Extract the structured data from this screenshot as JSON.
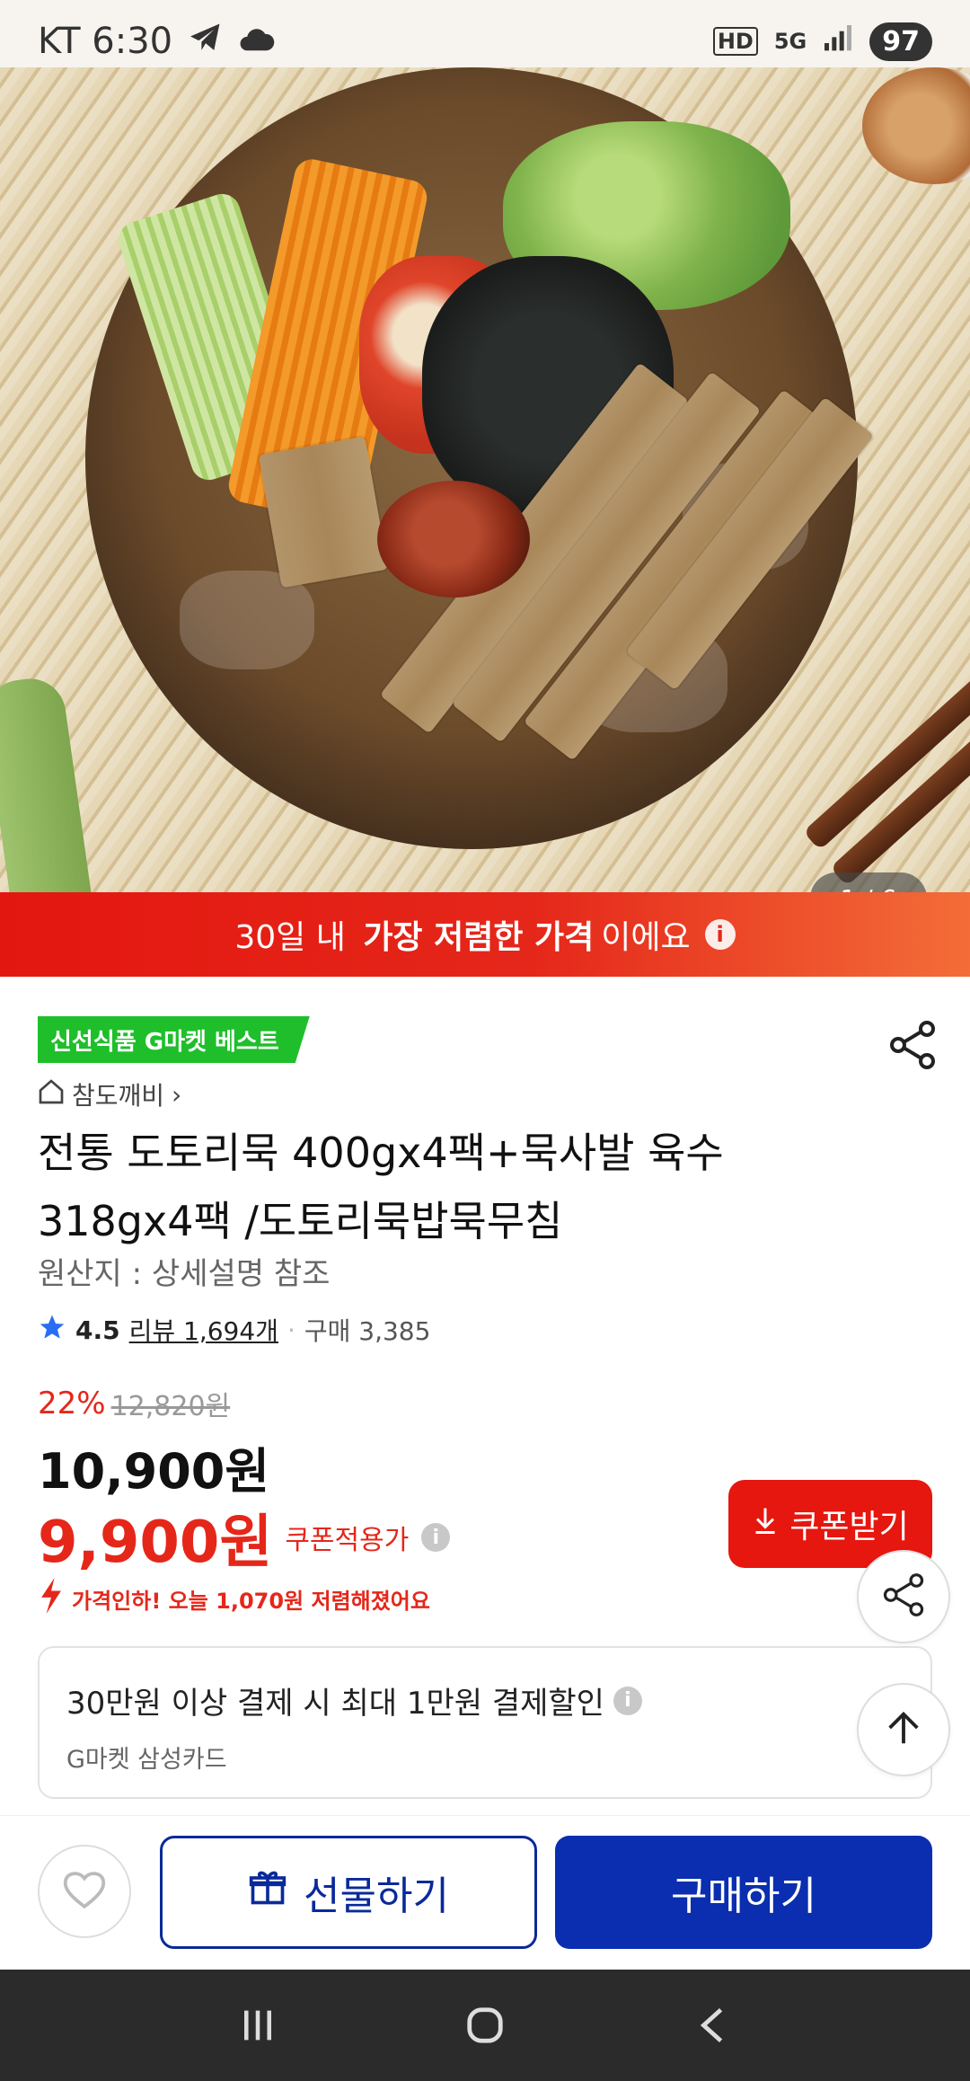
{
  "status_bar": {
    "carrier_time": "KT 6:30",
    "battery": "97",
    "indicators": [
      "HD",
      "5G"
    ]
  },
  "hero": {
    "image_counter": "1 / 6"
  },
  "banner": {
    "prefix": "30일 내 ",
    "bold": "가장 저렴한 가격",
    "suffix": "이에요",
    "info_icon": "i"
  },
  "product": {
    "badge": "신선식품 G마켓 베스트",
    "seller": "참도깨비",
    "seller_chevron": "›",
    "title_line1": "전통 도토리묵 400gx4팩+묵사발 육수",
    "title_line2": "318gx4팩 /도토리묵밥묵무침",
    "origin": "원산지 : 상세설명 참조",
    "rating": "4.5",
    "reviews": "리뷰 1,694개",
    "separator": "·",
    "purchases": "구매 3,385",
    "discount": "22%",
    "original_price": "12,820원",
    "price": "10,900원",
    "coupon_price": "9,900원",
    "coupon_label": "쿠폰적용가",
    "coupon_info_icon": "i",
    "price_drop": "가격인하! 오늘 1,070원 저렴해졌어요",
    "coupon_button": "쿠폰받기"
  },
  "card_offer": {
    "title": "30만원 이상 결제 시 최대 1만원 결제할인",
    "info_icon": "i",
    "subtitle": "G마켓 삼성카드"
  },
  "actions": {
    "gift": "선물하기",
    "buy": "구매하기"
  },
  "colors": {
    "accent_red": "#e5271a",
    "brand_blue": "#0a2eaf",
    "badge_green": "#1fbf2b"
  },
  "icons": [
    "telegram-icon",
    "cloud-icon",
    "share-icon",
    "home-icon",
    "star-icon",
    "download-icon",
    "arrow-up-icon",
    "heart-icon",
    "gift-icon",
    "recent-apps-icon",
    "home-nav-icon",
    "back-icon"
  ]
}
